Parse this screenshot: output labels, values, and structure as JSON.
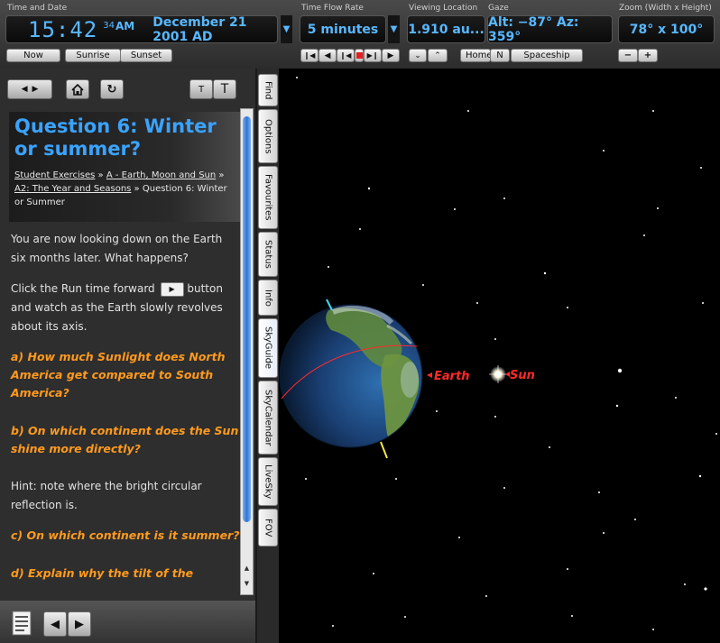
{
  "toolbar": {
    "time_date": {
      "label": "Time and Date",
      "clock_hm": "15:42",
      "clock_s": "34",
      "clock_ampm": "AM",
      "date": "December 21 2001 AD"
    },
    "time_flow": {
      "label": "Time Flow Rate",
      "value": "5 minutes"
    },
    "viewing_location": {
      "label": "Viewing Location",
      "value": "1.910 au..."
    },
    "gaze": {
      "label": "Gaze",
      "value": "Alt: −87° Az: 359°"
    },
    "zoom": {
      "label": "Zoom (Width x Height)",
      "value": "78° x 100°"
    },
    "buttons": {
      "now": "Now",
      "sunrise": "Sunrise",
      "sunset": "Sunset",
      "home": "Home",
      "n": "N",
      "spaceship": "Spaceship",
      "zoom_out": "−",
      "zoom_in": "+"
    }
  },
  "side_tabs": [
    "Find",
    "Options",
    "Favourites",
    "Status",
    "Info",
    "SkyGuide",
    "SkyCalendar",
    "LiveSky",
    "FOV"
  ],
  "guide": {
    "title": "Question 6: Winter or summer?",
    "breadcrumb": {
      "c1": "Student Exercises",
      "c2": "A - Earth, Moon and Sun",
      "c3": "A2: The Year and Seasons",
      "c4": "Question 6: Winter or Summer",
      "sep": " » "
    },
    "para1": "You are now looking down on the Earth six months later. What happens?",
    "para2a": "Click the Run time forward",
    "para2b": "button and watch as the Earth slowly revolves about its axis.",
    "qa": "a) How much Sunlight does North America get compared to South America?",
    "qb": "b) On which continent does the Sun shine more directly?",
    "hint": "Hint: note where the bright circular reflection is.",
    "qc": "c) On which continent is it summer?",
    "qd": "d) Explain why the tilt of the"
  },
  "sky": {
    "earth_label": "Earth",
    "sun_label": "Sun"
  },
  "colors": {
    "accent": "#58b8ff",
    "title": "#3aa3ff",
    "question": "#ff9a1e",
    "sky_label": "#ff2a2a"
  }
}
